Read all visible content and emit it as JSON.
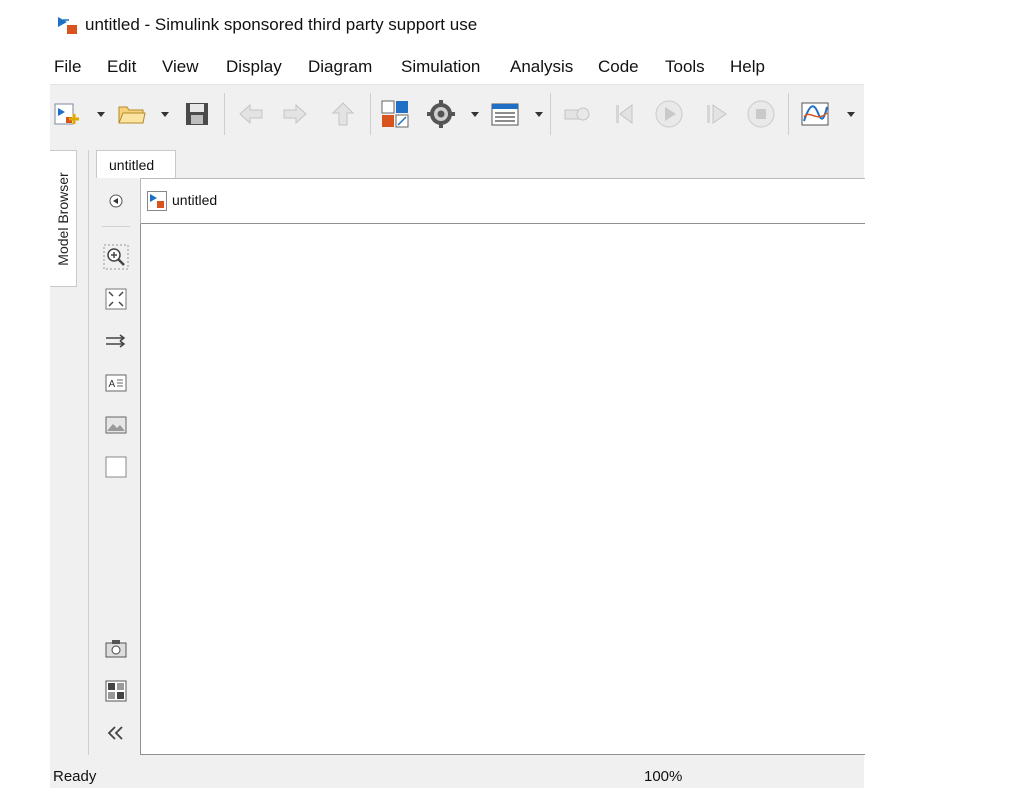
{
  "window": {
    "title": "untitled - Simulink sponsored third party support use",
    "icon": "simulink-model-icon"
  },
  "menubar": {
    "items": [
      "File",
      "Edit",
      "View",
      "Display",
      "Diagram",
      "Simulation",
      "Analysis",
      "Code",
      "Tools",
      "Help"
    ]
  },
  "toolbar": {
    "icons": [
      "new-model-icon",
      "open-folder-icon",
      "save-icon",
      "back-arrow-icon",
      "forward-arrow-icon",
      "up-arrow-icon",
      "library-browser-icon",
      "model-settings-gear-icon",
      "model-explorer-icon",
      "step-back-config-icon",
      "step-back-icon",
      "run-icon",
      "step-forward-icon",
      "stop-icon",
      "scope-icon"
    ]
  },
  "side_panel": {
    "model_browser_label": "Model Browser"
  },
  "tabs": [
    {
      "label": "untitled"
    }
  ],
  "breadcrumb": {
    "label": "untitled",
    "icon": "simulink-model-icon"
  },
  "palette": {
    "icons": [
      "hide-show-icon",
      "zoom-icon",
      "fit-to-view-icon",
      "route-lines-icon",
      "annotation-icon",
      "image-icon",
      "area-icon",
      "screenshot-camera-icon",
      "model-data-icon",
      "collapse-panel-icon"
    ]
  },
  "status": {
    "text": "Ready",
    "zoom": "100%"
  },
  "colors": {
    "accent_blue": "#1f6fc5",
    "accent_orange": "#d9531e",
    "toolbar_bg": "#f0f0f0"
  }
}
